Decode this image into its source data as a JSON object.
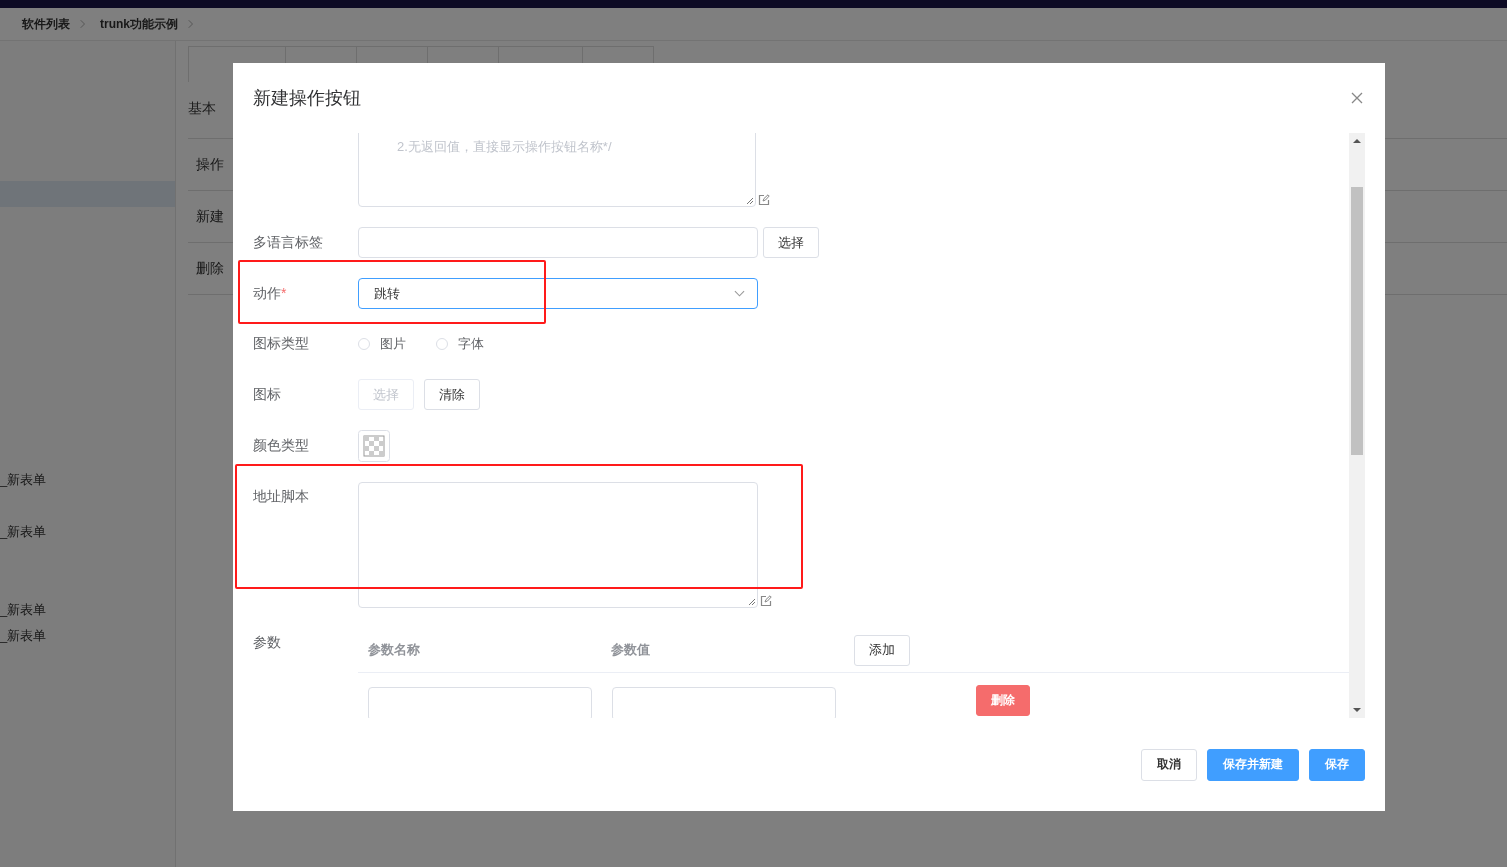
{
  "breadcrumb": [
    "软件列表",
    "trunk功能示例"
  ],
  "sidebar": {
    "items": [
      {
        "label": "_新表单"
      },
      {
        "label": "_新表单"
      },
      {
        "label": "_新表单"
      },
      {
        "label": "_新表单"
      }
    ]
  },
  "section_title": "基本",
  "operations_table": {
    "rows": [
      "操作",
      "新建",
      "删除"
    ]
  },
  "dialog": {
    "title": "新建操作按钮",
    "display_script": {
      "lines": [
        "2.无返回值，直接显示操作按钮名称*/"
      ]
    },
    "i18n_label": {
      "label": "多语言标签",
      "button": "选择"
    },
    "action": {
      "label": "动作",
      "required_mark": "*",
      "value": "跳转"
    },
    "icon_type": {
      "label": "图标类型",
      "options": [
        {
          "label": "图片",
          "selected": false
        },
        {
          "label": "字体",
          "selected": false
        }
      ]
    },
    "icon": {
      "label": "图标",
      "buttons": [
        {
          "label": "选择",
          "disabled": true
        },
        {
          "label": "清除",
          "disabled": false
        }
      ]
    },
    "color_type": {
      "label": "颜色类型"
    },
    "url_script": {
      "label": "地址脚本"
    },
    "params": {
      "label": "参数",
      "columns": [
        "参数名称",
        "参数值"
      ],
      "add_button": "添加",
      "rows": [
        {
          "delete_button": "删除"
        }
      ]
    },
    "footer_buttons": [
      {
        "label": "取消",
        "kind": "default"
      },
      {
        "label": "保存并新建",
        "kind": "primary"
      },
      {
        "label": "保存",
        "kind": "primary"
      }
    ]
  }
}
